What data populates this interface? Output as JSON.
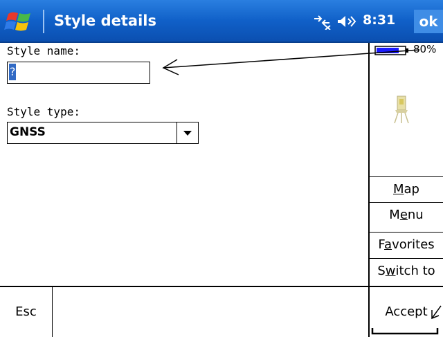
{
  "titlebar": {
    "title": "Style details",
    "clock": "8:31",
    "ok_label": "ok",
    "start_icon": "windows-flag-icon",
    "connectivity_icon": "connectivity-icon",
    "volume_icon": "speaker-icon"
  },
  "form": {
    "style_name_label": "Style name:",
    "style_name_value": "?",
    "style_type_label": "Style type:",
    "style_type_value": "GNSS"
  },
  "status": {
    "battery_text": "80%",
    "battery_level": 0.8,
    "battery_icon": "battery-icon",
    "device_icon": "total-station-icon"
  },
  "side_menu": [
    {
      "label": "Map",
      "access_key": "M"
    },
    {
      "label": "Menu",
      "access_key": "e"
    },
    {
      "label": "Favorites",
      "access_key": "a"
    },
    {
      "label": "Switch to",
      "access_key": "w"
    }
  ],
  "bottom": {
    "esc_label": "Esc",
    "accept_label": "Accept"
  },
  "colors": {
    "titlebar": "#1060c8",
    "selection": "#316ac5",
    "battery_fill": "#1a1aff"
  }
}
